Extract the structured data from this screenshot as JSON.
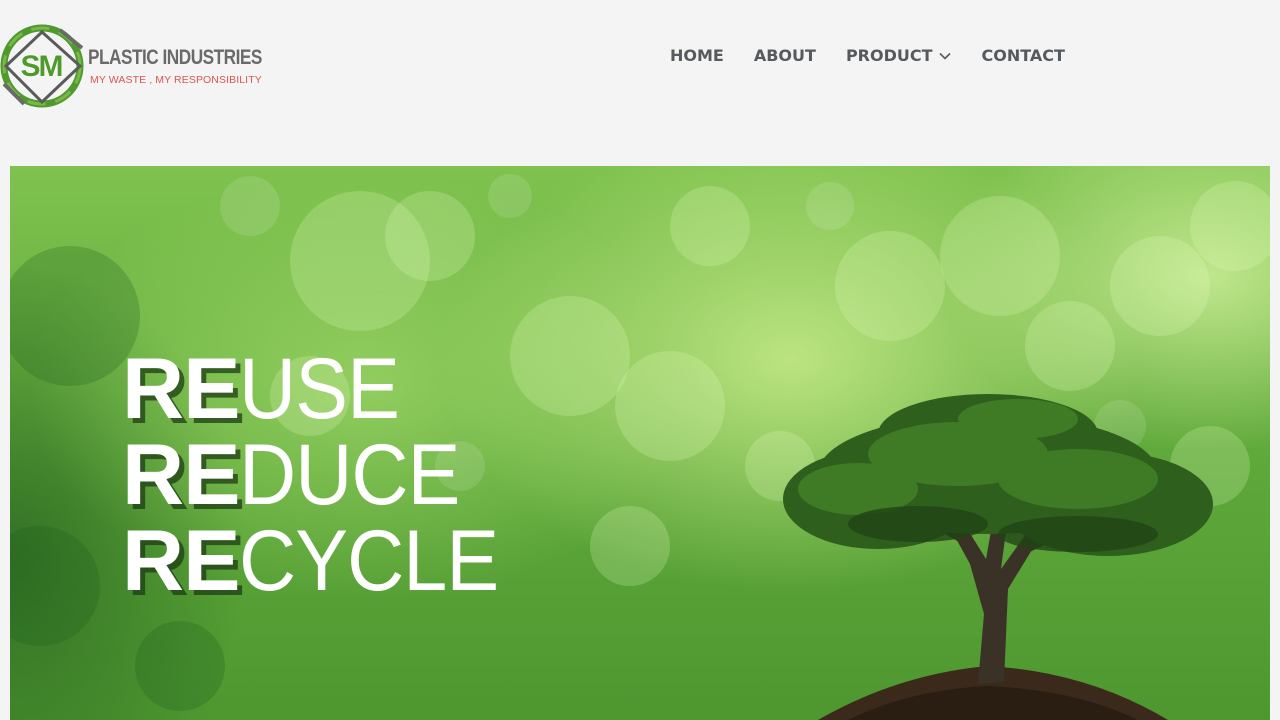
{
  "header": {
    "logo": {
      "monogram": "SM",
      "brand": "PLASTIC INDUSTRIES",
      "tagline": "MY WASTE , MY RESPONSIBILITY"
    },
    "nav": {
      "items": [
        {
          "label": "HOME"
        },
        {
          "label": "ABOUT"
        },
        {
          "label": "PRODUCT",
          "has_dropdown": true
        },
        {
          "label": "CONTACT"
        }
      ]
    }
  },
  "hero": {
    "slogan": [
      {
        "prefix": "RE",
        "suffix": "USE"
      },
      {
        "prefix": "RE",
        "suffix": "DUCE"
      },
      {
        "prefix": "RE",
        "suffix": "CYCLE"
      }
    ]
  },
  "colors": {
    "background": "#f4f4f4",
    "nav_text": "#555a5f",
    "brand_text": "#6a6a6a",
    "tagline_text": "#d9564f",
    "logo_green": "#4f9a2c",
    "hero_green": "#6bb543"
  },
  "icons": {
    "product_dropdown": "chevron-down-icon",
    "logo_mark": "sm-logo-icon"
  }
}
